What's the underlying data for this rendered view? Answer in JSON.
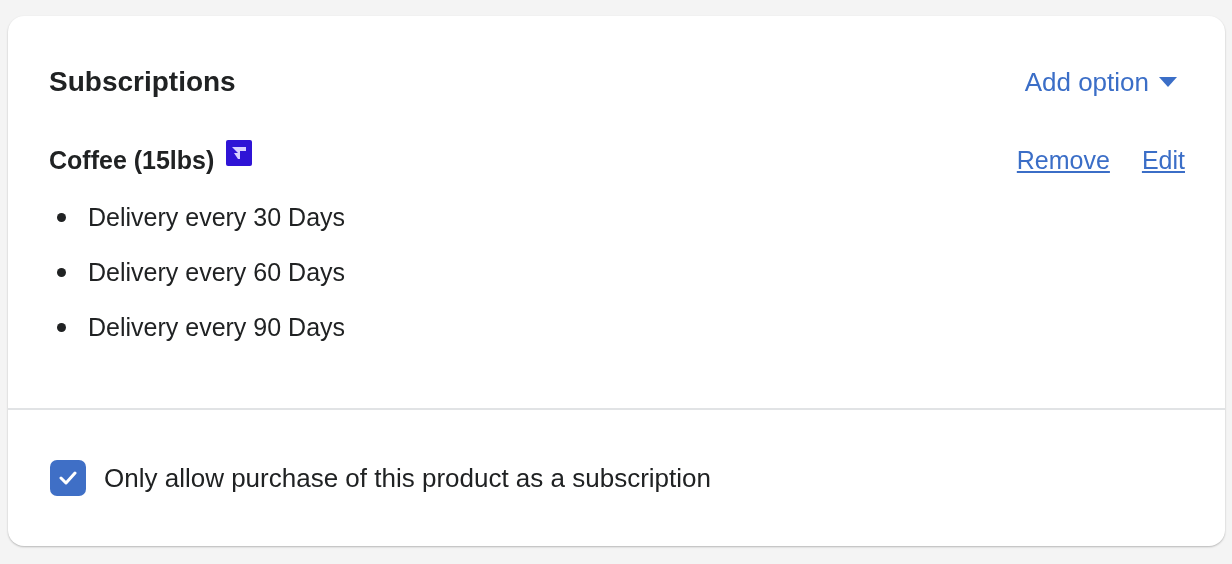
{
  "card": {
    "title": "Subscriptions",
    "add_option": "Add option",
    "product": {
      "name": "Coffee (15lbs)",
      "actions": [
        "Remove",
        "Edit"
      ],
      "options": [
        "Delivery every 30 Days",
        "Delivery every 60 Days",
        "Delivery every 90 Days"
      ]
    },
    "subscription_only": {
      "label": "Only allow purchase of this product as a subscription",
      "checked": true
    }
  }
}
